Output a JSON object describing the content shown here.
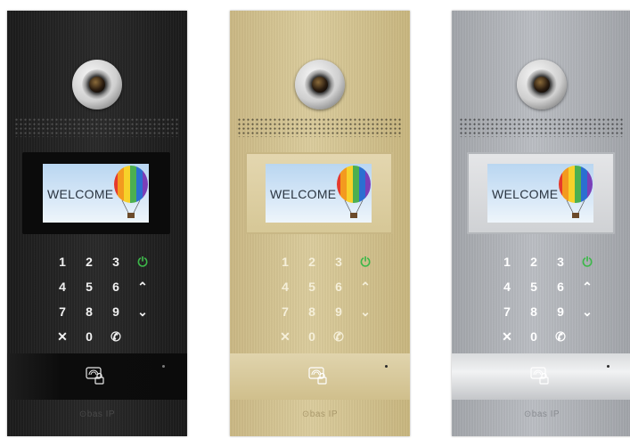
{
  "screen": {
    "welcome_text": "WELCOME"
  },
  "keypad": {
    "keys": [
      "1",
      "2",
      "3",
      "⏻",
      "4",
      "5",
      "6",
      "⌃",
      "7",
      "8",
      "9",
      "⌄",
      "✕",
      "0",
      "✆",
      ""
    ]
  },
  "brand": {
    "text": "⊙bas IP"
  },
  "panels": [
    {
      "finish": "black"
    },
    {
      "finish": "gold"
    },
    {
      "finish": "silver"
    }
  ],
  "colors": {
    "accept_key": "#3db84a",
    "black_finish": "#222222",
    "gold_finish": "#d2c290",
    "silver_finish": "#b1b4b8"
  }
}
